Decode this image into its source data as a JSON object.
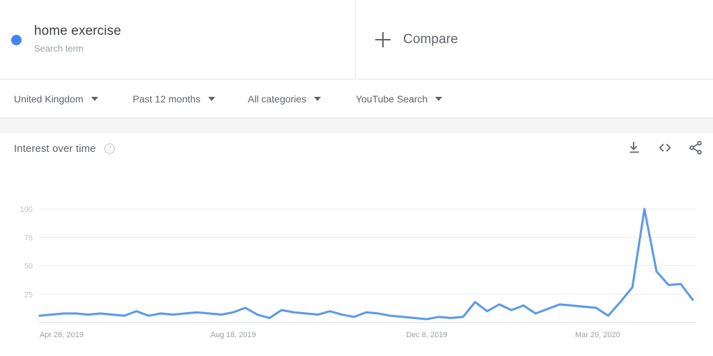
{
  "terms": {
    "items": [
      {
        "title": "home exercise",
        "subtitle": "Search term",
        "color": "#4285f4"
      }
    ],
    "compare_label": "Compare",
    "plus_icon": "plus-icon"
  },
  "filters": [
    {
      "name": "location",
      "label": "United Kingdom"
    },
    {
      "name": "time-range",
      "label": "Past 12 months"
    },
    {
      "name": "category",
      "label": "All categories"
    },
    {
      "name": "search-type",
      "label": "YouTube Search"
    }
  ],
  "chart_header": {
    "title": "Interest over time",
    "help_icon": "help-icon",
    "help_glyph": "?",
    "actions": [
      {
        "name": "download-icon",
        "label": "Download"
      },
      {
        "name": "embed-code-icon",
        "label": "Embed"
      },
      {
        "name": "share-icon",
        "label": "Share"
      }
    ]
  },
  "chart_data": {
    "type": "line",
    "title": "Interest over time",
    "xlabel": "",
    "ylabel": "",
    "ylim": [
      0,
      100
    ],
    "grid": true,
    "legend_position": "top",
    "line_color": "#5a9bea",
    "y_ticks": [
      100,
      75,
      50,
      25
    ],
    "x_ticks": [
      "Apr 28, 2019",
      "Aug 18, 2019",
      "Dec 8, 2019",
      "Mar 29, 2020"
    ],
    "x_tick_indices": [
      0,
      16,
      32,
      48
    ],
    "series": [
      {
        "name": "home exercise",
        "color": "#5a9bea",
        "x": [
          "Apr 28, 2019",
          "May 5, 2019",
          "May 12, 2019",
          "May 19, 2019",
          "May 26, 2019",
          "Jun 2, 2019",
          "Jun 9, 2019",
          "Jun 16, 2019",
          "Jun 23, 2019",
          "Jun 30, 2019",
          "Jul 7, 2019",
          "Jul 14, 2019",
          "Jul 21, 2019",
          "Jul 28, 2019",
          "Aug 4, 2019",
          "Aug 11, 2019",
          "Aug 18, 2019",
          "Aug 25, 2019",
          "Sep 1, 2019",
          "Sep 8, 2019",
          "Sep 15, 2019",
          "Sep 22, 2019",
          "Sep 29, 2019",
          "Oct 6, 2019",
          "Oct 13, 2019",
          "Oct 20, 2019",
          "Oct 27, 2019",
          "Nov 3, 2019",
          "Nov 10, 2019",
          "Nov 17, 2019",
          "Nov 24, 2019",
          "Dec 1, 2019",
          "Dec 8, 2019",
          "Dec 15, 2019",
          "Dec 22, 2019",
          "Dec 29, 2019",
          "Jan 5, 2020",
          "Jan 12, 2020",
          "Jan 19, 2020",
          "Jan 26, 2020",
          "Feb 2, 2020",
          "Feb 9, 2020",
          "Feb 16, 2020",
          "Feb 23, 2020",
          "Mar 1, 2020",
          "Mar 8, 2020",
          "Mar 15, 2020",
          "Mar 22, 2020",
          "Mar 29, 2020"
        ],
        "values": [
          6,
          7,
          8,
          8,
          7,
          8,
          7,
          6,
          10,
          6,
          8,
          7,
          8,
          9,
          8,
          7,
          9,
          13,
          7,
          4,
          11,
          9,
          8,
          7,
          10,
          7,
          5,
          9,
          8,
          6,
          5,
          4,
          3,
          5,
          4,
          5,
          18,
          10,
          16,
          11,
          15,
          8,
          12,
          16,
          15,
          14,
          13,
          6,
          18,
          31,
          100,
          45,
          33,
          34,
          20
        ],
        "max_value": 100,
        "max_label": "Mar 29, 2020"
      }
    ]
  }
}
